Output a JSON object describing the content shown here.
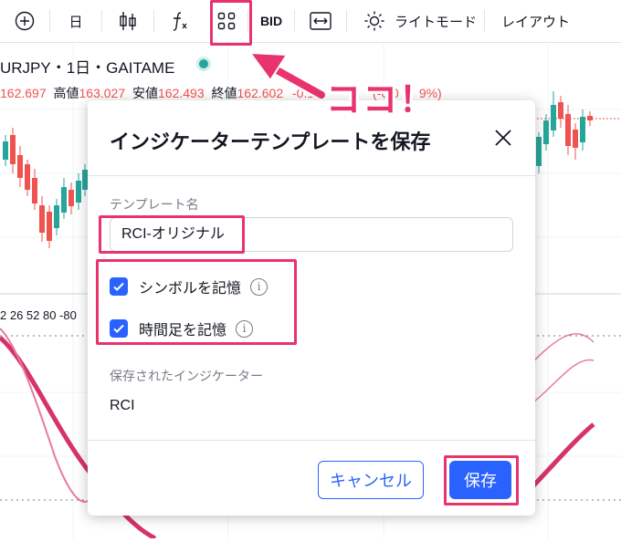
{
  "toolbar": {
    "interval": "日",
    "bid": "BID",
    "theme": "ライトモード",
    "layout": "レイアウト"
  },
  "chart": {
    "symbol": "URJPY・1日・GAITAME",
    "open_val": "162.697",
    "high_label": "高値",
    "high_val": "163.027",
    "low_label": "安値",
    "low_val": "162.493",
    "close_label": "終値",
    "close_val": "162.602",
    "change": "-0.1",
    "change_pct": "(-0.0",
    "change_end": "9%)",
    "rci_params": "2 26 52 80 -80"
  },
  "annotation": {
    "callout": "ココ！"
  },
  "dialog": {
    "title": "インジケーターテンプレートを保存",
    "field_label": "テンプレート名",
    "field_value": "RCI-オリジナル",
    "cb_symbol": "シンボルを記憶",
    "cb_interval": "時間足を記憶",
    "saved_label": "保存されたインジケーター",
    "saved_value": "RCI",
    "cancel": "キャンセル",
    "save": "保存"
  },
  "colors": {
    "accent": "#2962ff",
    "highlight": "#e8336d",
    "up": "#26a69a",
    "down": "#ef5350"
  }
}
